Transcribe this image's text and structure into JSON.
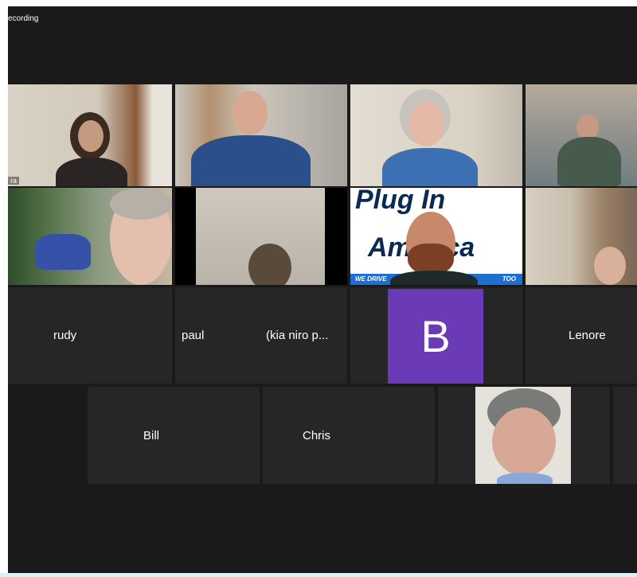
{
  "status": {
    "recording": "ecording"
  },
  "colors": {
    "background": "#1a1a1a",
    "tile": "#262626",
    "active_border": "#c9d86a",
    "avatar": "#6a3ab7"
  },
  "video_tiles": [
    {
      "name": "ra"
    },
    {
      "name": ""
    },
    {
      "name": ""
    },
    {
      "name": ""
    },
    {
      "name": ""
    },
    {
      "name": ""
    },
    {
      "name": ""
    },
    {
      "name": ""
    }
  ],
  "banner": {
    "line1": "Plug In",
    "line2": "America",
    "tagline_left": "WE DRIVE",
    "tagline_right": "TOO"
  },
  "name_tiles": {
    "rudy": "rudy",
    "paul": "paul",
    "kia": "(kia niro p...",
    "lenore": "Lenore",
    "bill": "Bill",
    "chris": "Chris"
  },
  "avatar_tile": {
    "initial": "B"
  }
}
